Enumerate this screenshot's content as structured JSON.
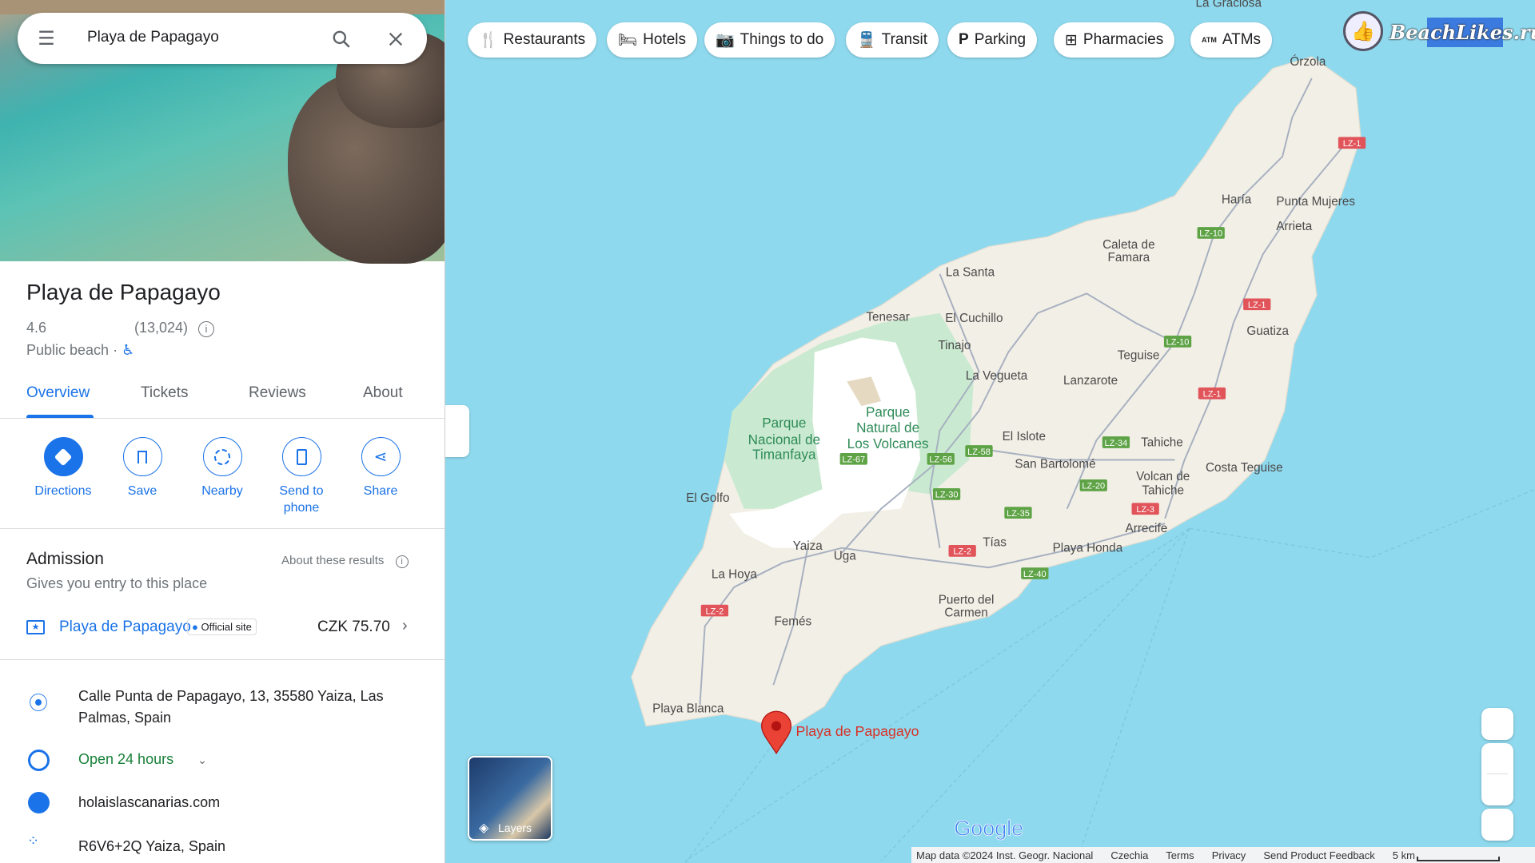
{
  "search": {
    "value": "Playa de Papagayo"
  },
  "place": {
    "title": "Playa de Papagayo",
    "rating": "4.6",
    "reviews": "(13,024)",
    "category": "Public beach",
    "separator": "·"
  },
  "tabs": [
    "Overview",
    "Tickets",
    "Reviews",
    "About"
  ],
  "actions": [
    "Directions",
    "Save",
    "Nearby",
    "Send to phone",
    "Share"
  ],
  "admission": {
    "title": "Admission",
    "about": "About these results",
    "subtitle": "Gives you entry to this place",
    "ticket_name": "Playa de Papagayo",
    "badge": "Official site",
    "price": "CZK 75.70"
  },
  "info": {
    "address": "Calle Punta de Papagayo, 13, 35580 Yaiza, Las Palmas, Spain",
    "hours": "Open 24 hours",
    "website": "holaislascanarias.com",
    "plus_code": "R6V6+2Q Yaiza, Spain"
  },
  "chips": [
    "Restaurants",
    "Hotels",
    "Things to do",
    "Transit",
    "Parking",
    "Pharmacies",
    "ATMs"
  ],
  "watermark": "BeachLikes.ru",
  "layers": "Layers",
  "google_logo": "Google",
  "map_labels": [
    "La Graciosa",
    "Órzola",
    "Haría",
    "Punta Mujeres",
    "Arrieta",
    "Caleta de",
    "Famara",
    "La Santa",
    "Tenesar",
    "El Cuchillo",
    "Tinajo",
    "La Vegueta",
    "Lanzarote",
    "Teguise",
    "Guatiza",
    "El Islote",
    "Tahiche",
    "San Bartolomé",
    "Costa Teguise",
    "Volcan de",
    "Tahiche",
    "El Golfo",
    "Arrecife",
    "Tías",
    "Playa Honda",
    "Yaiza",
    "Uga",
    "La Hoya",
    "Puerto del",
    "Carmen",
    "Femés",
    "Playa Blanca"
  ],
  "park_labels": [
    "Parque",
    "Nacional de",
    "Timanfaya",
    "Parque",
    "Natural de",
    "Los Volcanes"
  ],
  "pin_label": "Playa de Papagayo",
  "roads": [
    "LZ-1",
    "LZ-10",
    "LZ-1",
    "LZ-10",
    "LZ-1",
    "LZ-34",
    "LZ-58",
    "LZ-67",
    "LZ-56",
    "LZ-20",
    "LZ-30",
    "LZ-3",
    "LZ-35",
    "LZ-2",
    "LZ-40",
    "LZ-2"
  ],
  "attribution": {
    "data": "Map data ©2024 Inst. Geogr. Nacional",
    "country": "Czechia",
    "terms": "Terms",
    "privacy": "Privacy",
    "feedback": "Send Product Feedback",
    "scale": "5 km"
  },
  "colors": {
    "accent": "#1a73e8",
    "open": "#188038",
    "water": "#8fd9ee",
    "land": "#f2efe6",
    "park": "#c9ead0",
    "pin": "#ea4335"
  }
}
